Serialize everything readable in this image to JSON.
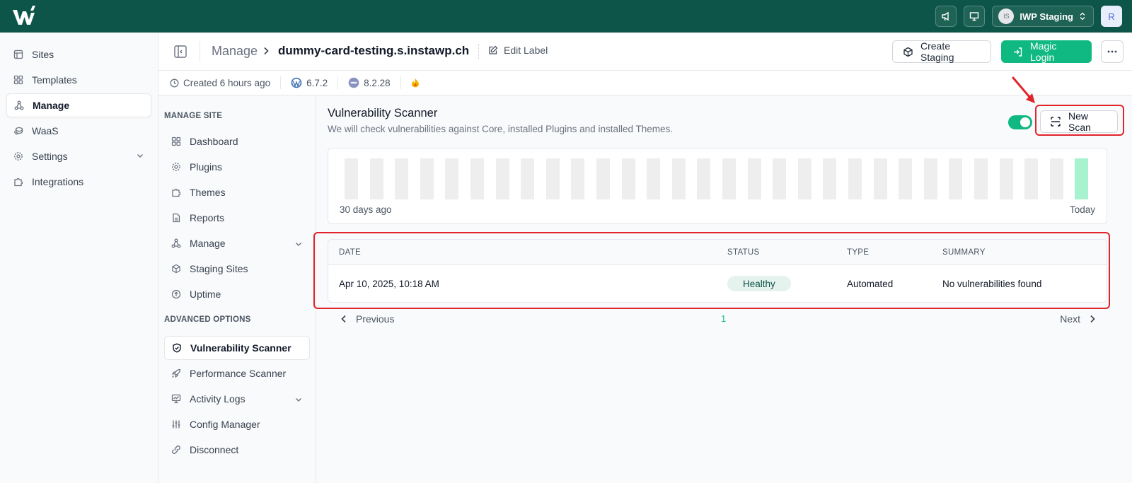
{
  "app": {
    "logo": "w-logo-icon",
    "top_actions": [
      "megaphone-icon",
      "presentation-icon"
    ],
    "team": {
      "initials": "IS",
      "name": "IWP Staging"
    },
    "user_initial": "R"
  },
  "leftnav": {
    "items": [
      {
        "label": "Sites",
        "icon": "layout-icon"
      },
      {
        "label": "Templates",
        "icon": "grid-icon"
      },
      {
        "label": "Manage",
        "icon": "nodes-icon",
        "active": true
      },
      {
        "label": "WaaS",
        "icon": "coins-icon"
      },
      {
        "label": "Settings",
        "icon": "gear-icon",
        "expandable": true
      },
      {
        "label": "Integrations",
        "icon": "puzzle-icon"
      }
    ]
  },
  "header": {
    "crumb_root": "Manage",
    "site_name": "dummy-card-testing.s.instawp.ch",
    "edit_label": "Edit Label",
    "create_staging": "Create Staging",
    "magic_login": "Magic Login"
  },
  "infobar": {
    "created": "Created 6 hours ago",
    "wp_version": "6.7.2",
    "php_version": "8.2.28"
  },
  "sidenav": {
    "manage_title": "MANAGE SITE",
    "manage_items": [
      {
        "label": "Dashboard",
        "icon": "grid-icon"
      },
      {
        "label": "Plugins",
        "icon": "gear-icon"
      },
      {
        "label": "Themes",
        "icon": "puzzle-icon"
      },
      {
        "label": "Reports",
        "icon": "document-icon"
      },
      {
        "label": "Manage",
        "icon": "nodes-icon",
        "expandable": true
      },
      {
        "label": "Staging Sites",
        "icon": "box-icon"
      },
      {
        "label": "Uptime",
        "icon": "arrow-up-circle-icon"
      }
    ],
    "advanced_title": "ADVANCED OPTIONS",
    "advanced_items": [
      {
        "label": "Vulnerability Scanner",
        "icon": "shield-icon",
        "active": true
      },
      {
        "label": "Performance Scanner",
        "icon": "rocket-icon"
      },
      {
        "label": "Activity Logs",
        "icon": "chart-board-icon",
        "expandable": true
      },
      {
        "label": "Config Manager",
        "icon": "sliders-icon"
      },
      {
        "label": "Disconnect",
        "icon": "link-icon"
      }
    ]
  },
  "scanner": {
    "title": "Vulnerability Scanner",
    "description": "We will check vulnerabilities against Core, installed Plugins and installed Themes.",
    "auto_scan_enabled": true,
    "new_scan_label": "New Scan",
    "history": {
      "days": 30,
      "scanned_days": [
        30
      ],
      "left_label": "30 days ago",
      "right_label": "Today",
      "ok_color": "#a7f3d0",
      "empty_color": "#eeeeee"
    },
    "table": {
      "columns": [
        "DATE",
        "STATUS",
        "TYPE",
        "SUMMARY"
      ],
      "rows": [
        {
          "date": "Apr 10, 2025, 10:18 AM",
          "status": "Healthy",
          "type": "Automated",
          "summary": "No vulnerabilities found"
        }
      ]
    },
    "pagination": {
      "previous": "Previous",
      "page": "1",
      "next": "Next"
    }
  },
  "colors": {
    "brand": "#0c5548",
    "accent": "#10b981",
    "highlight": "#e0242b"
  }
}
